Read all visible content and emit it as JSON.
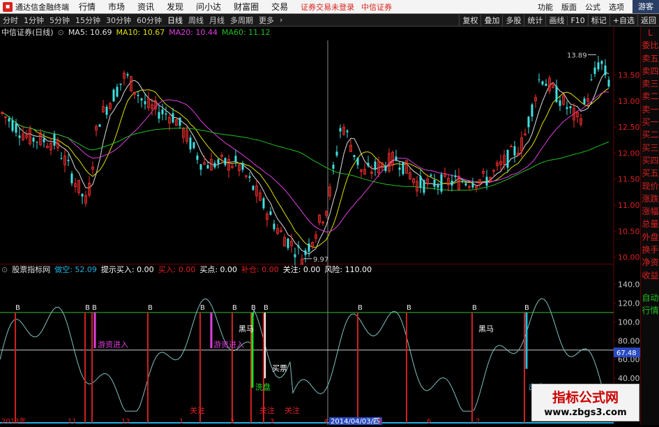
{
  "menubar": {
    "app_title": "通达信金融终端",
    "items": [
      "行情",
      "市场",
      "资讯",
      "发现",
      "问小达",
      "财富圈",
      "交易"
    ],
    "warn1": "证券交易未登录",
    "warn2": "中信证券",
    "right_items": [
      "功能",
      "版面",
      "公式",
      "选项"
    ],
    "guest": "游客"
  },
  "periods": [
    "分时",
    "1分钟",
    "5分钟",
    "15分钟",
    "30分钟",
    "60分钟",
    "日线",
    "周线",
    "月线",
    "多周期",
    "更多"
  ],
  "active_period": "日线",
  "tools": [
    "复权",
    "叠加",
    "多股",
    "统计",
    "画线",
    "F10",
    "标记",
    "+自选",
    "返回"
  ],
  "sidebar": {
    "top": "L",
    "items": [
      "委比",
      "卖五",
      "卖四",
      "卖三",
      "卖二",
      "卖一",
      "买一",
      "买二",
      "买三",
      "买四",
      "买五",
      "现价",
      "涨跌",
      "涨幅",
      "总量",
      "外盘",
      "换手",
      "净资",
      "收益"
    ],
    "bottom": [
      "自动",
      "行情"
    ]
  },
  "main_legend": {
    "title": "中信证券(日线)",
    "ma5": "MA5: 10.69",
    "ma10": "MA10: 10.67",
    "ma20": "MA20: 10.44",
    "ma60": "MA60: 11.12"
  },
  "sub_legend": {
    "title": "股票指标网",
    "items": [
      {
        "label": "做空: ",
        "value": "52.09",
        "color": "#20b0e0"
      },
      {
        "label": "提示买入: ",
        "value": "0.00",
        "color": "#ffffff"
      },
      {
        "label": "买入: ",
        "value": "0.00",
        "color": "#e02020"
      },
      {
        "label": "买点: ",
        "value": "0.00",
        "color": "#ffffff"
      },
      {
        "label": "补仓: ",
        "value": "0.00",
        "color": "#e02020"
      },
      {
        "label": "关注: ",
        "value": "0.00",
        "color": "#ffffff"
      },
      {
        "label": "风险: ",
        "value": "110.00",
        "color": "#ffffff"
      }
    ]
  },
  "main_y_ticks": [
    "13.50",
    "13.00",
    "12.50",
    "12.00",
    "11.50",
    "11.00",
    "10.50",
    "10.00"
  ],
  "sub_y_ticks": [
    "140.00",
    "120.00",
    "100.00",
    "80.00",
    "60.00",
    "40.00",
    "20.00"
  ],
  "sub_current": "67.48",
  "annotations": {
    "high": "13.89",
    "low": "9.97",
    "buy_signal": "B",
    "heima": "黑马",
    "xipan": "洗盘",
    "maipiao": "买票",
    "zhuli": "游资进入",
    "zhuli2": "游资进入",
    "chutao": "出逃",
    "guanzhu": "关注"
  },
  "x_ticks": [
    "2013年",
    "11",
    "12",
    "1",
    "2",
    "3",
    "4",
    "2014/04/03/四",
    "5",
    "6",
    "7"
  ],
  "watermark": {
    "title": "指标公式网",
    "url": "www.zbgs3.com"
  },
  "colors": {
    "up": "#ff3030",
    "down": "#40e0e0",
    "ma5": "#e0e0e0",
    "ma10": "#e0e000",
    "ma20": "#e040e0",
    "ma60": "#20c020"
  }
}
